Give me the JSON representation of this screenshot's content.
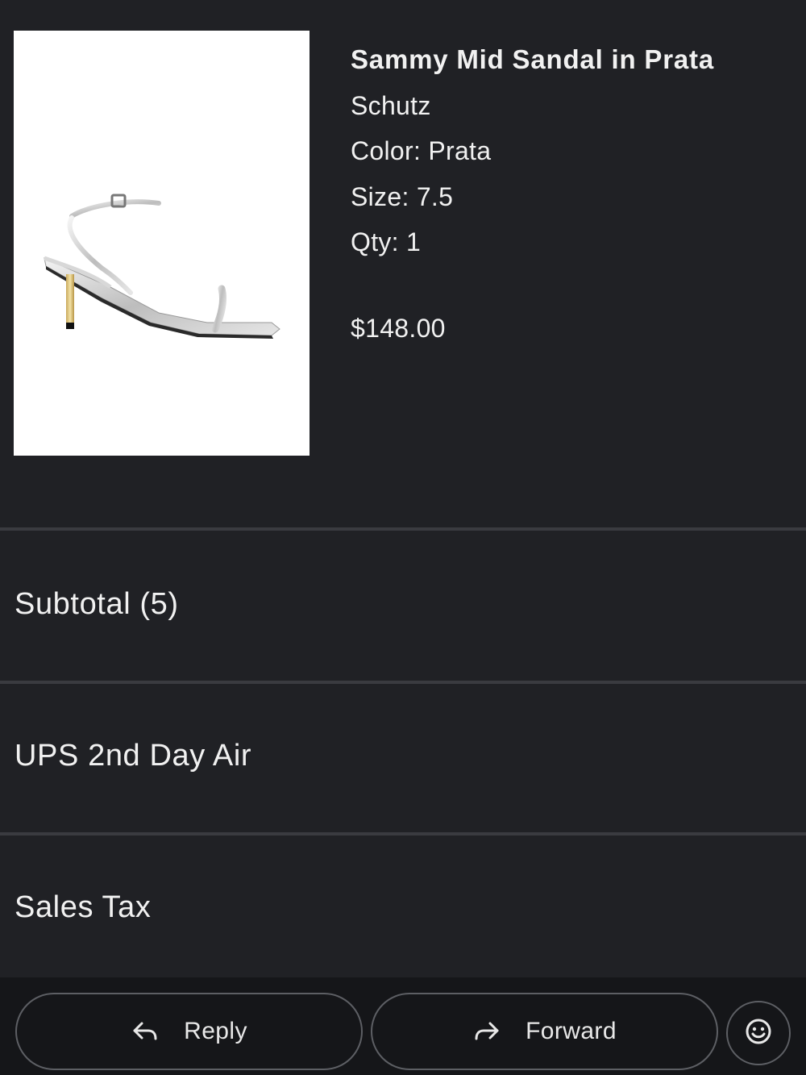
{
  "product": {
    "name": "Sammy Mid Sandal in Prata",
    "brand": "Schutz",
    "color": "Color: Prata",
    "size": "Size: 7.5",
    "qty": "Qty: 1",
    "price": "$148.00"
  },
  "summary": {
    "subtotal_label": "Subtotal (5)",
    "shipping_label": "UPS 2nd Day Air",
    "tax_label": "Sales Tax"
  },
  "actions": {
    "reply_label": "Reply",
    "forward_label": "Forward",
    "reply_icon": "reply-arrow-icon",
    "forward_icon": "forward-arrow-icon",
    "emoji_icon": "smiley-face-icon"
  },
  "colors": {
    "background": "#202125",
    "action_bar": "#151619",
    "divider": "#3a3b40",
    "text": "#f1f1f1"
  }
}
